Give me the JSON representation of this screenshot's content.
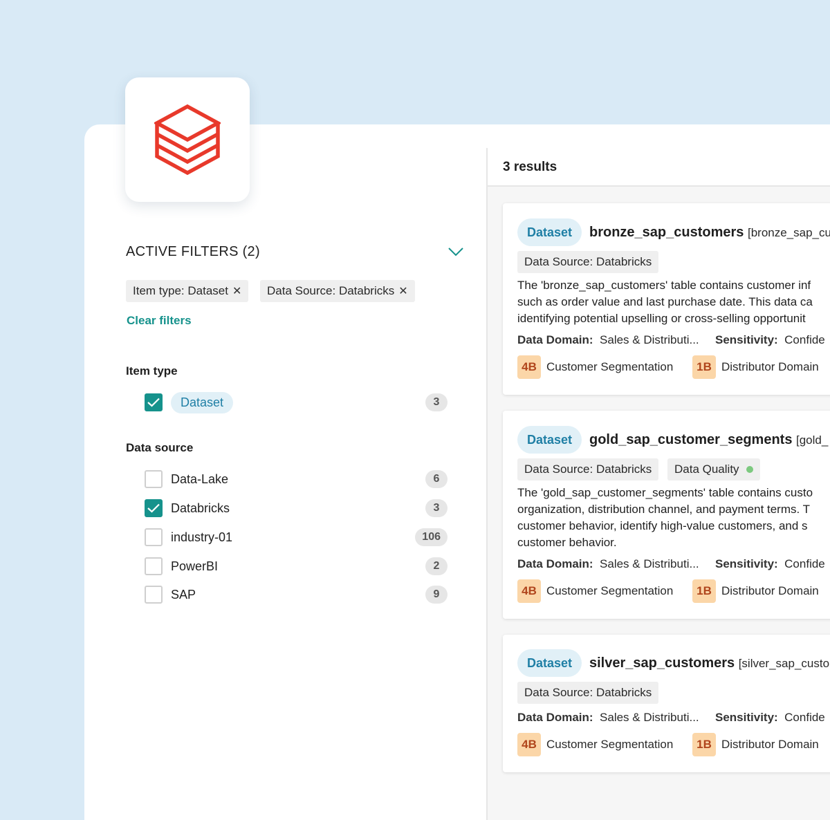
{
  "active_filters": {
    "title": "ACTIVE FILTERS (2)",
    "chips": [
      {
        "label": "Item type: Dataset"
      },
      {
        "label": "Data Source: Databricks"
      }
    ],
    "clear_label": "Clear filters"
  },
  "item_type": {
    "title": "Item type",
    "options": [
      {
        "label": "Dataset",
        "count": "3",
        "checked": true
      }
    ]
  },
  "data_source": {
    "title": "Data source",
    "options": [
      {
        "label": "Data-Lake",
        "count": "6",
        "checked": false
      },
      {
        "label": "Databricks",
        "count": "3",
        "checked": true
      },
      {
        "label": "industry-01",
        "count": "106",
        "checked": false
      },
      {
        "label": "PowerBI",
        "count": "2",
        "checked": false
      },
      {
        "label": "SAP",
        "count": "9",
        "checked": false
      }
    ]
  },
  "results": {
    "title": "3 results",
    "items": [
      {
        "type": "Dataset",
        "name": "bronze_sap_customers",
        "alias": "[bronze_sap_cu",
        "tags": [
          "Data Source: Databricks"
        ],
        "description": [
          "The 'bronze_sap_customers' table contains customer inf",
          "such as order value and last purchase date. This data ca",
          "identifying potential upselling or cross-selling opportunit"
        ],
        "domain_label": "Data Domain:",
        "domain_value": "Sales & Distributi...",
        "sensitivity_label": "Sensitivity:",
        "sensitivity_value": "Confide",
        "glossary": [
          {
            "badge": "4B",
            "label": "Customer Segmentation"
          },
          {
            "badge": "1B",
            "label": "Distributor Domain"
          }
        ]
      },
      {
        "type": "Dataset",
        "name": "gold_sap_customer_segments",
        "alias": "[gold_",
        "tags": [
          "Data Source: Databricks",
          "Data Quality"
        ],
        "description": [
          "The 'gold_sap_customer_segments' table contains custo",
          "organization, distribution channel, and payment terms. T",
          "customer behavior, identify high-value customers, and s",
          "customer behavior."
        ],
        "domain_label": "Data Domain:",
        "domain_value": "Sales & Distributi...",
        "sensitivity_label": "Sensitivity:",
        "sensitivity_value": "Confide",
        "glossary": [
          {
            "badge": "4B",
            "label": "Customer Segmentation"
          },
          {
            "badge": "1B",
            "label": "Distributor Domain"
          }
        ]
      },
      {
        "type": "Dataset",
        "name": "silver_sap_customers",
        "alias": "[silver_sap_custo",
        "tags": [
          "Data Source: Databricks"
        ],
        "description": [],
        "domain_label": "Data Domain:",
        "domain_value": "Sales & Distributi...",
        "sensitivity_label": "Sensitivity:",
        "sensitivity_value": "Confide",
        "glossary": [
          {
            "badge": "4B",
            "label": "Customer Segmentation"
          },
          {
            "badge": "1B",
            "label": "Distributor Domain"
          }
        ]
      }
    ]
  },
  "colors": {
    "accent": "#16928c",
    "logo": "#e8392b",
    "pill_text": "#1f7fa5",
    "badge_bg": "#fbd6a8"
  }
}
